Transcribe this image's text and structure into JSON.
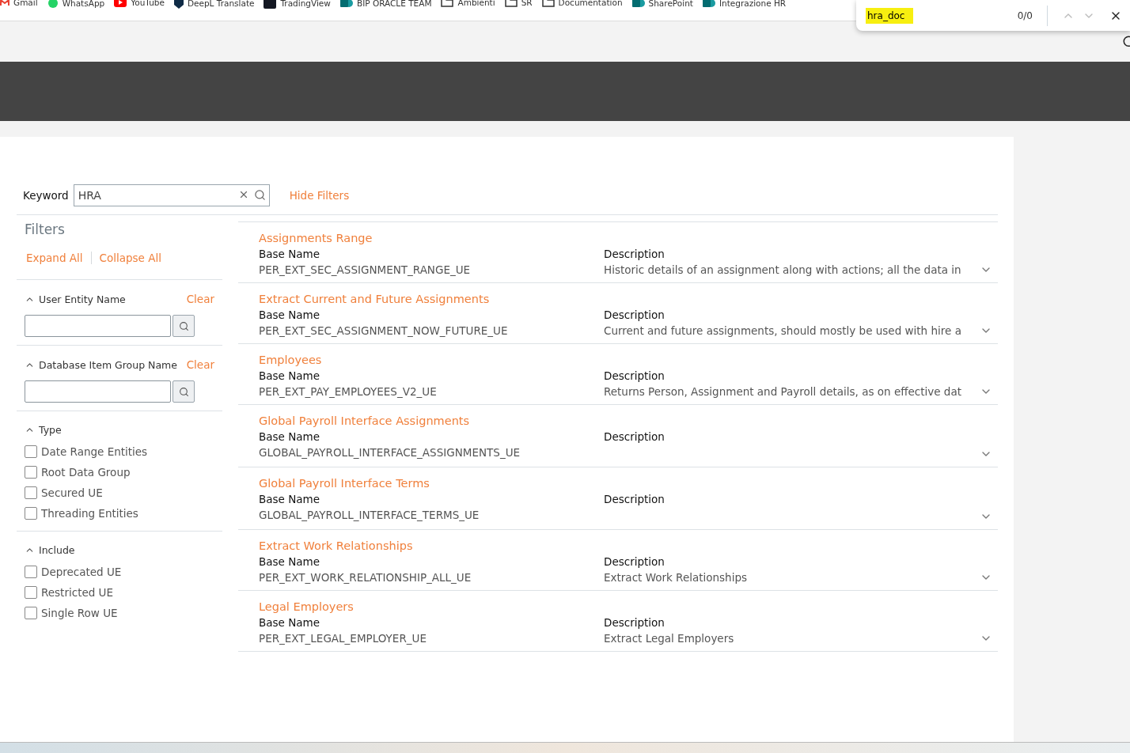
{
  "bookmarks": [
    {
      "label": "Gmail",
      "kind": "mail"
    },
    {
      "label": "WhatsApp",
      "kind": "chat"
    },
    {
      "label": "YouTube",
      "kind": "play"
    },
    {
      "label": "DeepL Translate",
      "kind": "shield"
    },
    {
      "label": "TradingView",
      "kind": "tile"
    },
    {
      "label": "BIP ORACLE TEAM",
      "kind": "site"
    },
    {
      "label": "Ambienti",
      "kind": "folder"
    },
    {
      "label": "SR",
      "kind": "folder"
    },
    {
      "label": "Documentation",
      "kind": "folder"
    },
    {
      "label": "SharePoint",
      "kind": "site"
    },
    {
      "label": "Integrazione HR",
      "kind": "site"
    }
  ],
  "find_bar": {
    "value": "hra_doc",
    "count": "0/0"
  },
  "search": {
    "keyword_label": "Keyword",
    "keyword_value": "HRA",
    "hide_filters": "Hide Filters"
  },
  "filters": {
    "title": "Filters",
    "expand_all": "Expand All",
    "collapse_all": "Collapse All",
    "sections": [
      {
        "kind": "search",
        "title": "User Entity Name",
        "clear": "Clear",
        "expanded": true
      },
      {
        "kind": "search",
        "title": "Database Item Group Name",
        "clear": "Clear",
        "expanded": true
      },
      {
        "kind": "checks",
        "title": "Type",
        "expanded": true,
        "options": [
          {
            "label": "Date Range Entities",
            "checked": false
          },
          {
            "label": "Root Data Group",
            "checked": false
          },
          {
            "label": "Secured UE",
            "checked": false
          },
          {
            "label": "Threading Entities",
            "checked": false
          }
        ]
      },
      {
        "kind": "checks",
        "title": "Include",
        "expanded": true,
        "options": [
          {
            "label": "Deprecated UE",
            "checked": false
          },
          {
            "label": "Restricted UE",
            "checked": false
          },
          {
            "label": "Single Row UE",
            "checked": false
          }
        ]
      }
    ]
  },
  "results": [
    {
      "title": "Assignments Range",
      "base_label": "Base Name",
      "base_name": "PER_EXT_SEC_ASSIGNMENT_RANGE_UE",
      "desc_label": "Description",
      "description": "Historic details of an assignment along with actions; all the data in",
      "expanded": false
    },
    {
      "title": "Extract Current and Future Assignments",
      "base_label": "Base Name",
      "base_name": "PER_EXT_SEC_ASSIGNMENT_NOW_FUTURE_UE",
      "desc_label": "Description",
      "description": "Current and future assignments, should mostly be used with hire a",
      "expanded": false
    },
    {
      "title": "Employees",
      "base_label": "Base Name",
      "base_name": "PER_EXT_PAY_EMPLOYEES_V2_UE",
      "desc_label": "Description",
      "description": "Returns Person, Assignment and Payroll details, as on effective dat",
      "expanded": false
    },
    {
      "title": "Global Payroll Interface Assignments",
      "base_label": "Base Name",
      "base_name": "GLOBAL_PAYROLL_INTERFACE_ASSIGNMENTS_UE",
      "desc_label": "Description",
      "expanded": false
    },
    {
      "title": "Global Payroll Interface Terms",
      "base_label": "Base Name",
      "base_name": "GLOBAL_PAYROLL_INTERFACE_TERMS_UE",
      "desc_label": "Description",
      "expanded": false
    },
    {
      "title": "Extract Work Relationships",
      "base_label": "Base Name",
      "base_name": "PER_EXT_WORK_RELATIONSHIP_ALL_UE",
      "desc_label": "Description",
      "description": "Extract Work Relationships",
      "expanded": false
    },
    {
      "title": "Legal Employers",
      "base_label": "Base Name",
      "base_name": "PER_EXT_LEGAL_EMPLOYER_UE",
      "desc_label": "Description",
      "description": "Extract Legal Employers",
      "expanded": false
    }
  ]
}
